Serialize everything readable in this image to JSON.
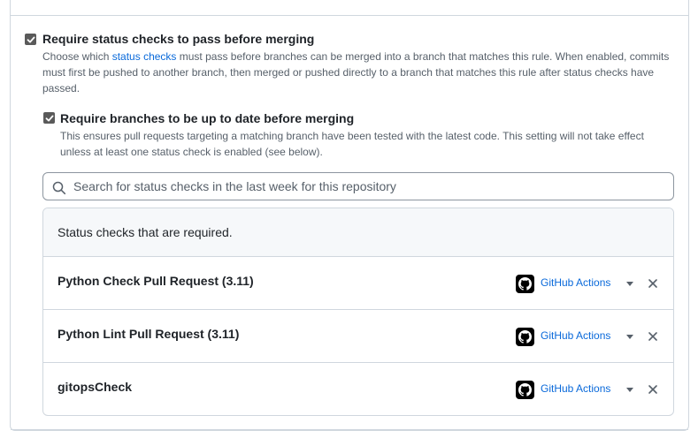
{
  "top_hint": "",
  "status_checks": {
    "checked": true,
    "label": "Require status checks to pass before merging",
    "desc_prefix": "Choose which ",
    "desc_link": "status checks",
    "desc_suffix": " must pass before branches can be merged into a branch that matches this rule. When enabled, commits must first be pushed to another branch, then merged or pushed directly to a branch that matches this rule after status checks have passed."
  },
  "up_to_date": {
    "checked": true,
    "label": "Require branches to be up to date before merging",
    "desc": "This ensures pull requests targeting a matching branch have been tested with the latest code. This setting will not take effect unless at least one status check is enabled (see below)."
  },
  "search": {
    "placeholder": "Search for status checks in the last week for this repository",
    "value": ""
  },
  "required_checks": {
    "header": "Status checks that are required.",
    "items": [
      {
        "name": "Python Check Pull Request (3.11)",
        "app": "GitHub Actions"
      },
      {
        "name": "Python Lint Pull Request (3.11)",
        "app": "GitHub Actions"
      },
      {
        "name": "gitopsCheck",
        "app": "GitHub Actions"
      }
    ]
  },
  "icons": {
    "checkbox": "checkbox-checked-icon",
    "search": "search-icon",
    "app": "github-mark-icon",
    "caret": "caret-down-icon",
    "remove": "x-icon"
  },
  "colors": {
    "link": "#0969da",
    "border": "#d0d7de",
    "header_bg": "#f6f8fa",
    "text": "#1f2328",
    "muted": "#57606a"
  }
}
